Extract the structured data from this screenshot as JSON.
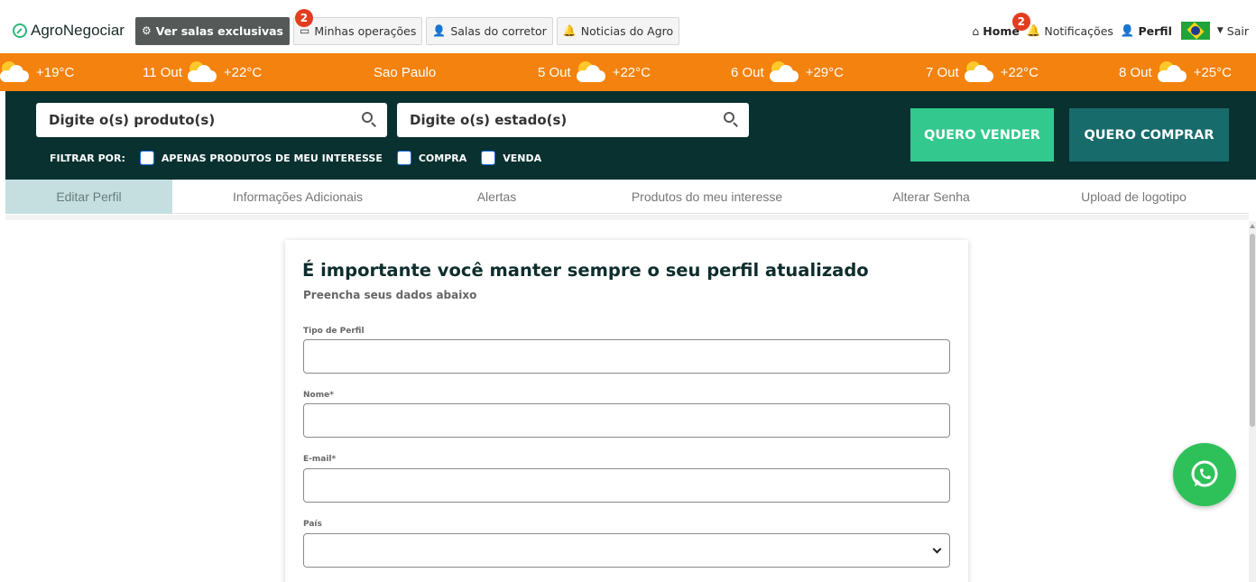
{
  "logo": {
    "text": "AgroNegociar"
  },
  "nav": {
    "exclusive_rooms": "Ver salas exclusivas",
    "my_operations": "Minhas operações",
    "my_operations_badge": "2",
    "broker_rooms": "Salas do corretor",
    "agro_news": "Noticias do Agro",
    "home": "Home",
    "notifications": "Notificações",
    "notifications_badge": "2",
    "profile": "Perfil",
    "logout": "Sair"
  },
  "weather": [
    {
      "date": "",
      "temp": "+19°C"
    },
    {
      "date": "11 Out",
      "temp": "+22°C"
    },
    {
      "date": "Sao Paulo",
      "temp": ""
    },
    {
      "date": "5 Out",
      "temp": "+22°C"
    },
    {
      "date": "6 Out",
      "temp": "+29°C"
    },
    {
      "date": "7 Out",
      "temp": "+22°C"
    },
    {
      "date": "8 Out",
      "temp": "+25°C"
    }
  ],
  "search": {
    "products_placeholder": "Digite o(s) produto(s)",
    "states_placeholder": "Digite o(s) estado(s)",
    "filter_label": "FILTRAR POR:",
    "filter_interest": "APENAS PRODUTOS DE MEU INTERESSE",
    "filter_buy": "COMPRA",
    "filter_sell": "VENDA",
    "sell_button": "QUERO VENDER",
    "buy_button": "QUERO COMPRAR"
  },
  "tabs": [
    "Editar Perfil",
    "Informações Adicionais",
    "Alertas",
    "Produtos do meu interesse",
    "Alterar Senha",
    "Upload de logotipo"
  ],
  "form": {
    "title": "É importante você manter sempre o seu perfil atualizado",
    "subtitle": "Preencha seus dados abaixo",
    "profile_type_label": "Tipo de Perfil",
    "name_label": "Nome*",
    "email_label": "E-mail*",
    "country_label": "País"
  },
  "colors": {
    "weather_bar": "#f3820e",
    "search_bg": "#083130",
    "sell_button": "#33c98e",
    "buy_button": "#186b6b",
    "badge": "#e23d1f",
    "whatsapp": "#2ec15a"
  }
}
